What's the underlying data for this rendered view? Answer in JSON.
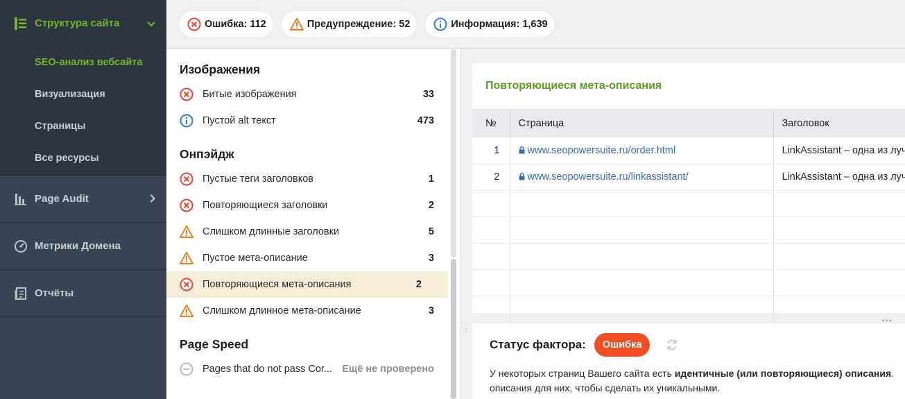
{
  "sidebar": {
    "site_structure": {
      "label": "Структура сайта",
      "icon": "site-structure-icon",
      "chevron": "⌄"
    },
    "sub_items": [
      {
        "label": "SEO-анализ вебсайта",
        "active": true
      },
      {
        "label": "Визуализация"
      },
      {
        "label": "Страницы"
      },
      {
        "label": "Все ресурсы"
      }
    ],
    "page_audit": {
      "label": "Page Audit",
      "icon": "page-audit-icon",
      "chevron": "›"
    },
    "domain_metrics": {
      "label": "Метрики Домена",
      "icon": "gauge-icon"
    },
    "reports": {
      "label": "Отчёты",
      "icon": "report-icon"
    }
  },
  "summary": {
    "error": "Ошибка: 112",
    "warning": "Предупреждение: 52",
    "info": "Информация: 1,639"
  },
  "groups": [
    {
      "title": "Изображения",
      "rows": [
        {
          "icon": "error",
          "label": "Битые изображения",
          "count": "33"
        },
        {
          "icon": "info",
          "label": "Пустой alt текст",
          "count": "473"
        }
      ]
    },
    {
      "title": "Онпэйдж",
      "rows": [
        {
          "icon": "error",
          "label": "Пустые теги заголовков",
          "count": "1"
        },
        {
          "icon": "error",
          "label": "Повторяющиеся заголовки",
          "count": "2"
        },
        {
          "icon": "warning",
          "label": "Слишком длинные заголовки",
          "count": "5"
        },
        {
          "icon": "warning",
          "label": "Пустое мета-описание",
          "count": "3"
        },
        {
          "icon": "error",
          "label": "Повторяющиеся мета-описания",
          "count": "2",
          "active": true
        },
        {
          "icon": "warning",
          "label": "Слишком длинное мета-описание",
          "count": "3"
        }
      ]
    },
    {
      "title": "Page Speed",
      "rows": [
        {
          "icon": "not-checked",
          "label": "Pages that do not pass Cor...",
          "count": "Ещё не проверено"
        }
      ]
    }
  ],
  "details": {
    "title": "Повторяющиеся мета-описания",
    "columns": {
      "num": "№",
      "page": "Страница",
      "heading": "Заголовок"
    },
    "rows": [
      {
        "num": "1",
        "page": "www.seopowersuite.ru/order.html",
        "heading": "LinkAssistant – одна из луч"
      },
      {
        "num": "2",
        "page": "www.seopowersuite.ru/linkassistant/",
        "heading": "LinkAssistant – одна из луч"
      }
    ],
    "empty_rows": 5
  },
  "status": {
    "label": "Статус фактора:",
    "badge": "Ошибка",
    "desc_line1_pre": "У некоторых страниц Вашего сайта есть ",
    "desc_line1_bold": "идентичные (или повторяющиеся) описания",
    "desc_line1_post": ".",
    "desc_line2": "описания для них, чтобы сделать их уникальными."
  },
  "colors": {
    "accent_green": "#6fb82a",
    "error_red": "#e04a3a",
    "warning_orange": "#f07d22",
    "info_blue": "#2f7fd0",
    "sidebar_bg": "#3a4553"
  }
}
